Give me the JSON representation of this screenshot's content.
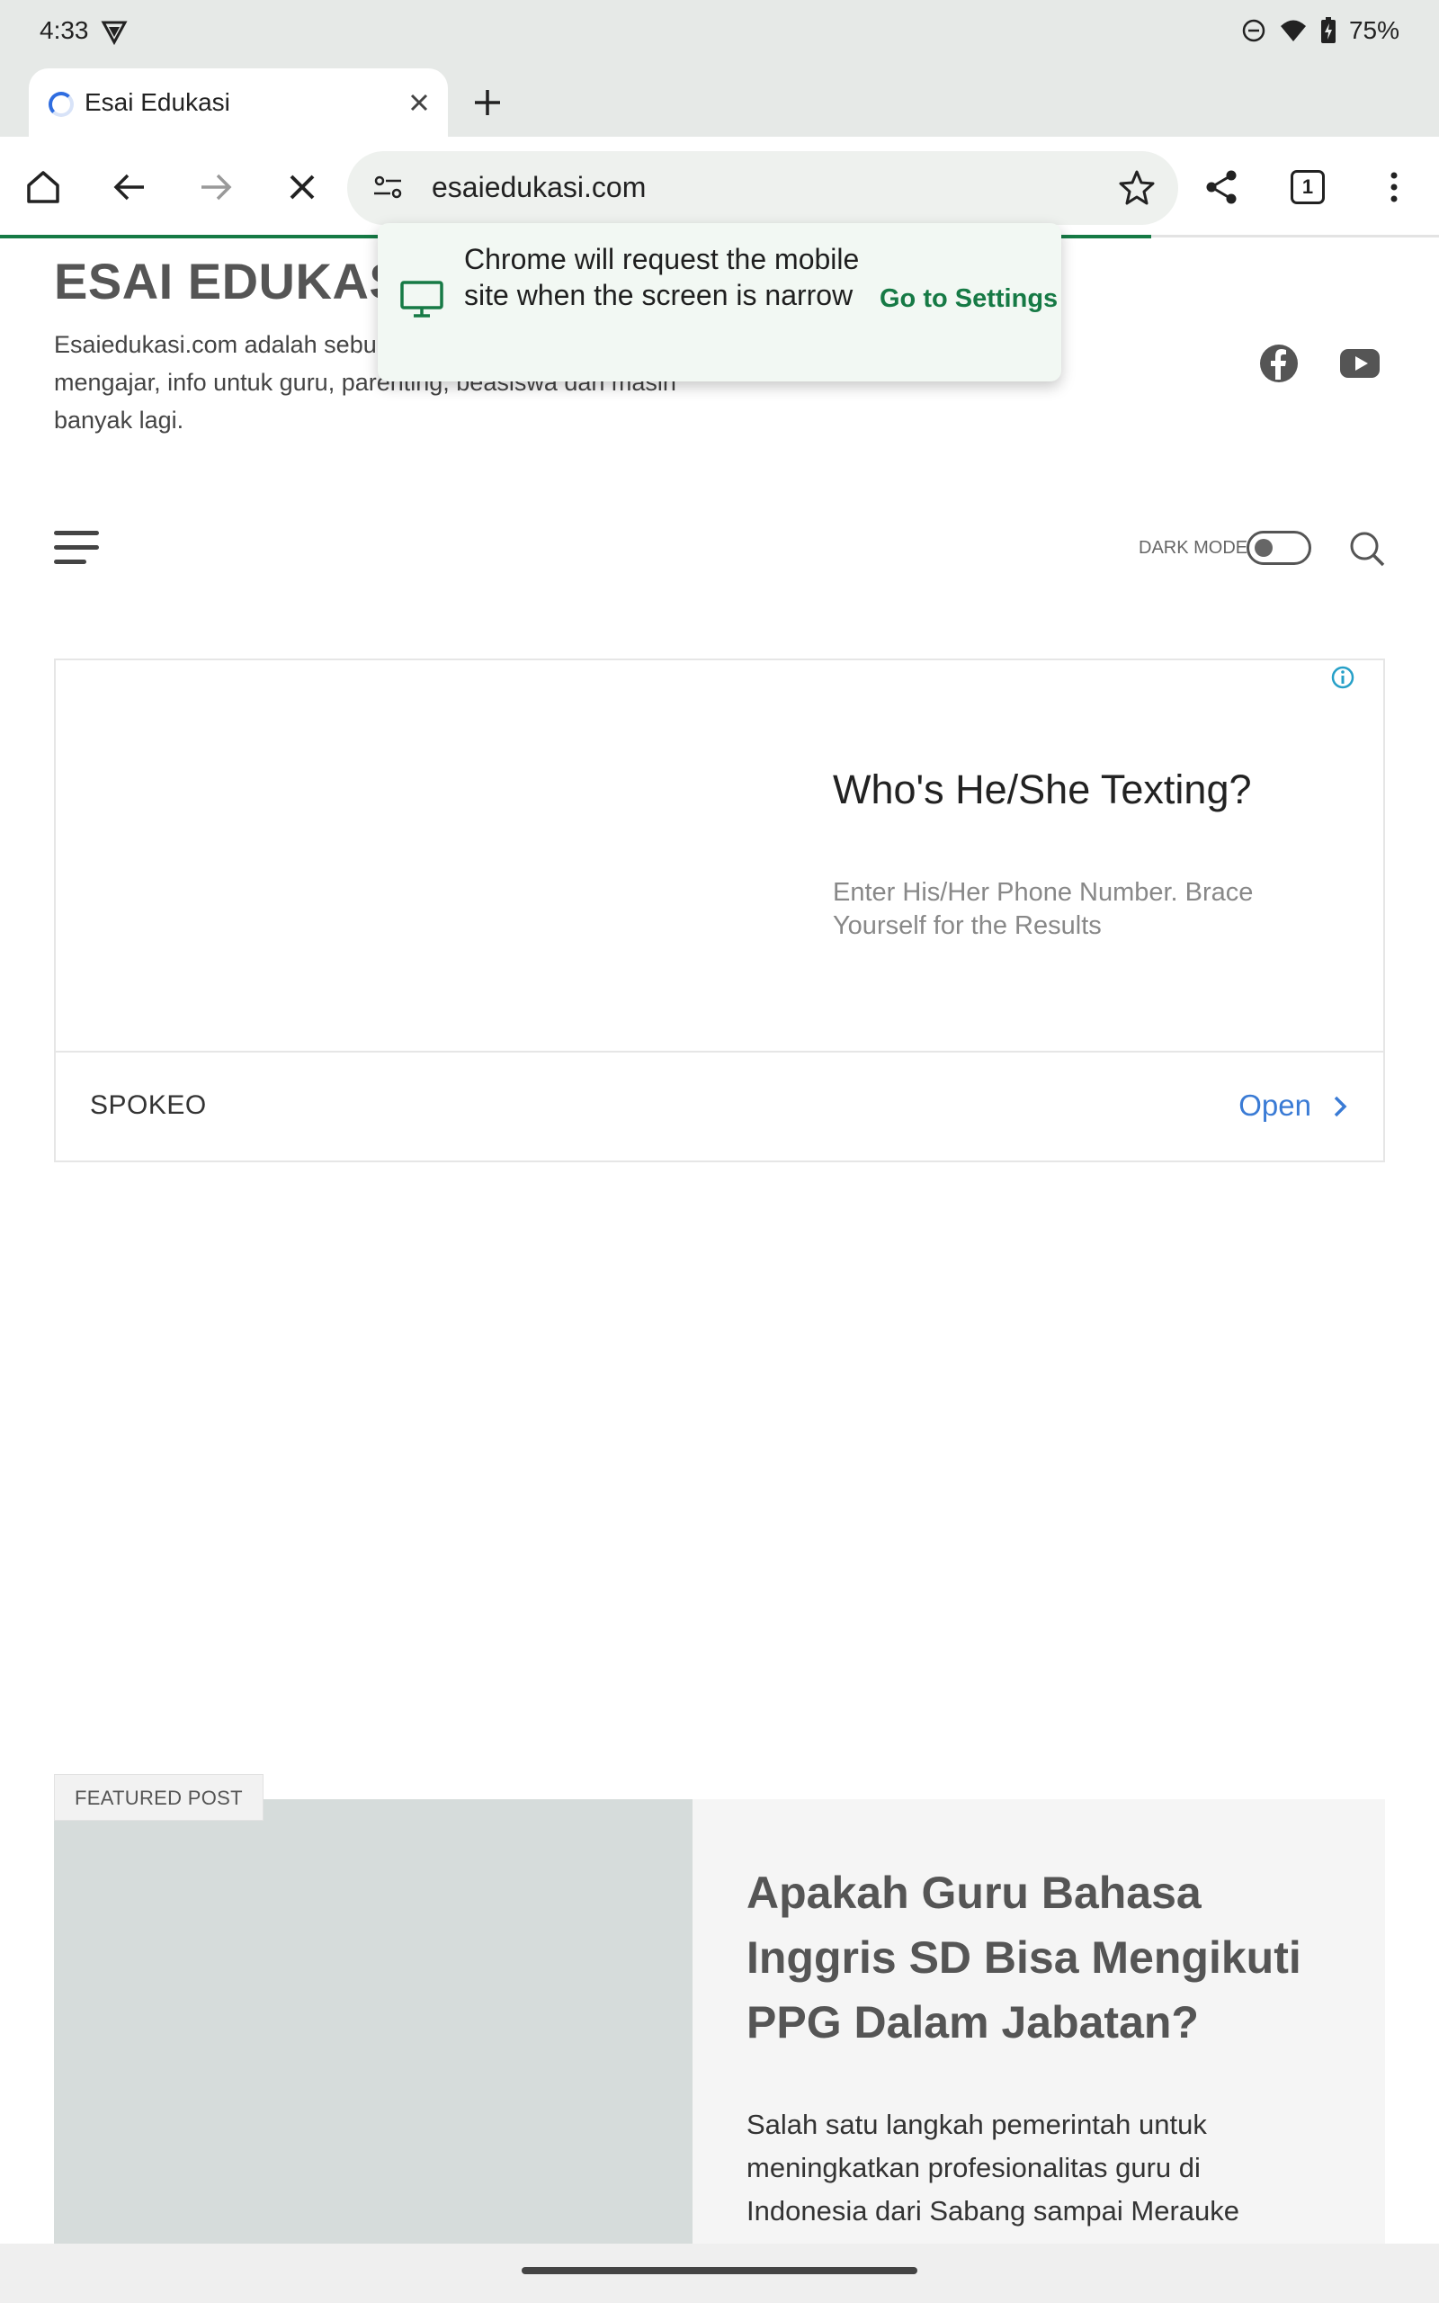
{
  "status_bar": {
    "time": "4:33",
    "battery": "75%",
    "icons": [
      "shield-icon",
      "dnd-icon",
      "wifi-icon",
      "battery-icon"
    ]
  },
  "browser": {
    "tab_title": "Esai Edukasi",
    "url": "esaiedukasi.com",
    "tab_count": "1",
    "accent_color": "#167a45"
  },
  "popup": {
    "message": "Chrome will request the mobile site when the screen is narrow",
    "action": "Go to Settings"
  },
  "site": {
    "title": "ESAI EDUKASI",
    "description": "Esaiedukasi.com adalah sebu membahas berbagai hal sepu mengajar, info untuk guru, parenting, beasiswa dan masih banyak lagi.",
    "dark_mode_label": "DARK MODE",
    "dark_mode_on": false
  },
  "ad": {
    "headline": "Who's He/She Texting?",
    "body": "Enter His/Her Phone Number. Brace Yourself for the Results",
    "brand": "SPOKEO",
    "cta": "Open"
  },
  "featured": {
    "badge": "FEATURED POST",
    "title": "Apakah Guru Bahasa Inggris SD Bisa Mengikuti PPG Dalam Jabatan?",
    "excerpt": "Salah satu langkah pemerintah untuk meningkatkan profesionalitas guru di Indonesia dari Sabang sampai Merauke adalah de…"
  }
}
